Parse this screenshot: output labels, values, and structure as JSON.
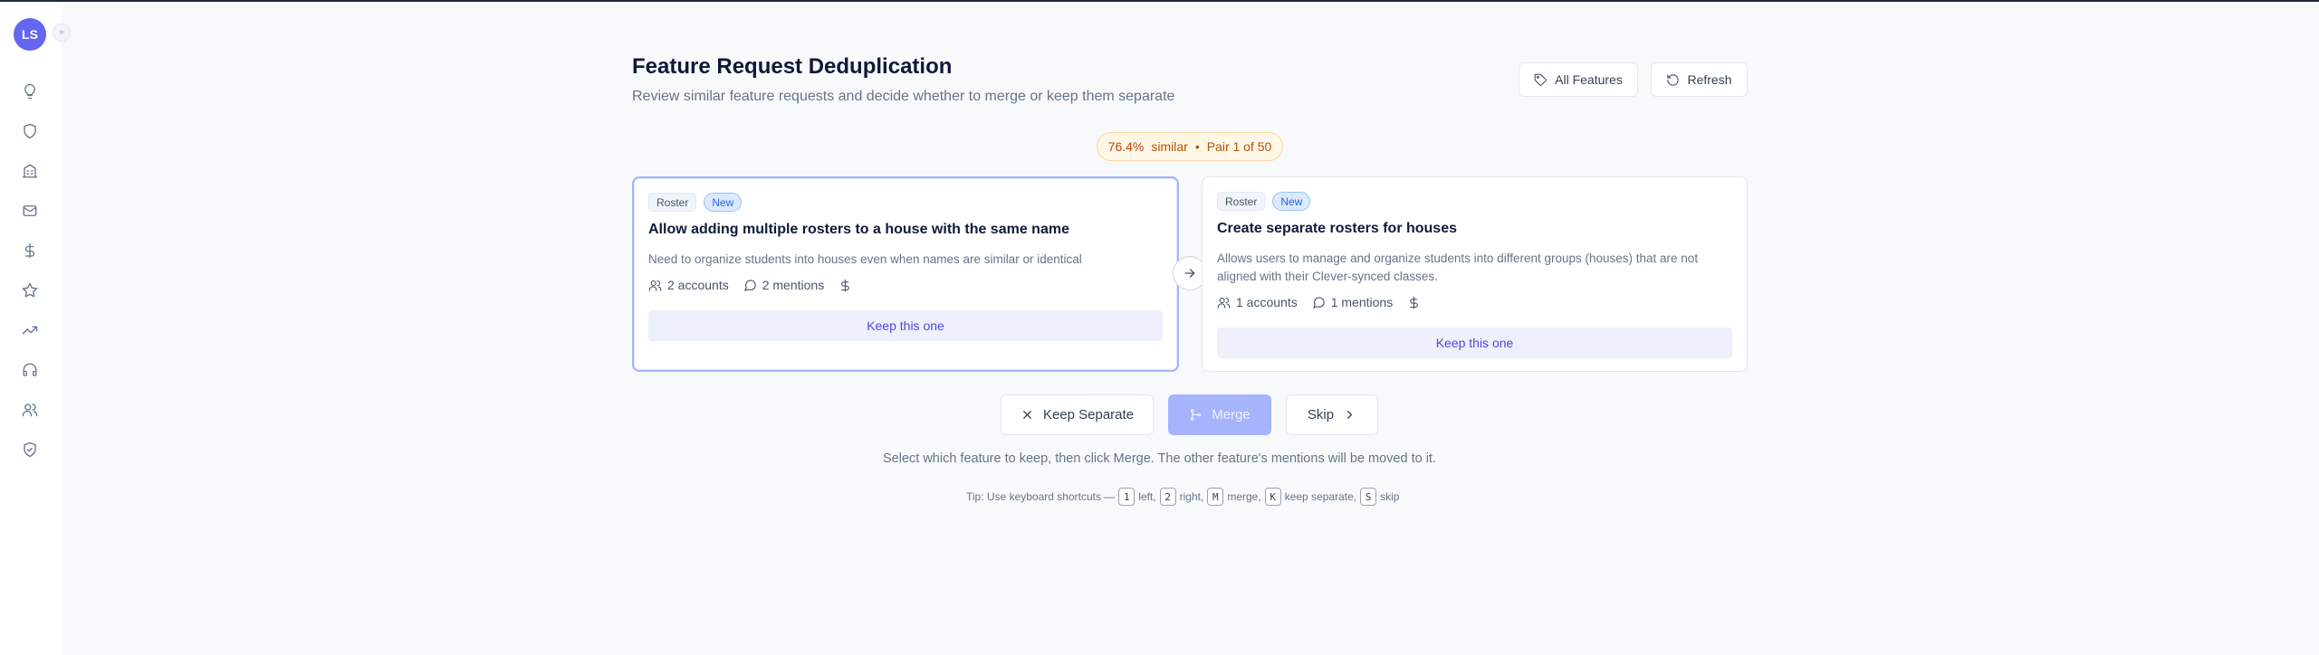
{
  "user": {
    "initials": "LS"
  },
  "sidebar": {
    "expand_icon": "chevrons-right-icon",
    "items": [
      {
        "icon": "lightbulb-icon"
      },
      {
        "icon": "shield-icon"
      },
      {
        "icon": "building-icon"
      },
      {
        "icon": "mail-icon"
      },
      {
        "icon": "dollar-icon"
      },
      {
        "icon": "star-icon"
      },
      {
        "icon": "trending-up-icon"
      },
      {
        "icon": "headset-icon"
      },
      {
        "icon": "users-icon"
      },
      {
        "icon": "shield-check-icon"
      }
    ]
  },
  "header": {
    "title": "Feature Request Deduplication",
    "subtitle": "Review similar feature requests and decide whether to merge or keep them separate",
    "all_features_label": "All Features",
    "refresh_label": "Refresh"
  },
  "similarity": {
    "percent": "76.4%",
    "similar_label": "similar",
    "separator": "•",
    "pair_label": "Pair 1 of 50"
  },
  "left_card": {
    "category": "Roster",
    "status": "New",
    "title": "Allow adding multiple rosters to a house with the same name",
    "description": "Need to organize students into houses even when names are similar or identical",
    "accounts": "2 accounts",
    "mentions": "2 mentions",
    "keep_label": "Keep this one"
  },
  "right_card": {
    "category": "Roster",
    "status": "New",
    "title": "Create separate rosters for houses",
    "description": "Allows users to manage and organize students into different groups (houses) that are not aligned with their Clever-synced classes.",
    "accounts": "1 accounts",
    "mentions": "1 mentions",
    "keep_label": "Keep this one"
  },
  "actions": {
    "keep_separate": "Keep Separate",
    "merge": "Merge",
    "skip": "Skip"
  },
  "instruction": "Select which feature to keep, then click Merge. The other feature's mentions will be moved to it.",
  "tip": {
    "prefix": "Tip: Use keyboard shortcuts —",
    "shortcuts": [
      {
        "key": "1",
        "label": "left,"
      },
      {
        "key": "2",
        "label": "right,"
      },
      {
        "key": "M",
        "label": "merge,"
      },
      {
        "key": "K",
        "label": "keep separate,"
      },
      {
        "key": "S",
        "label": "skip"
      }
    ]
  },
  "colors": {
    "accent": "#6366f1",
    "merge_disabled": "#a5b4fc",
    "badge_bg": "#fff7e6",
    "badge_text": "#b45309"
  }
}
